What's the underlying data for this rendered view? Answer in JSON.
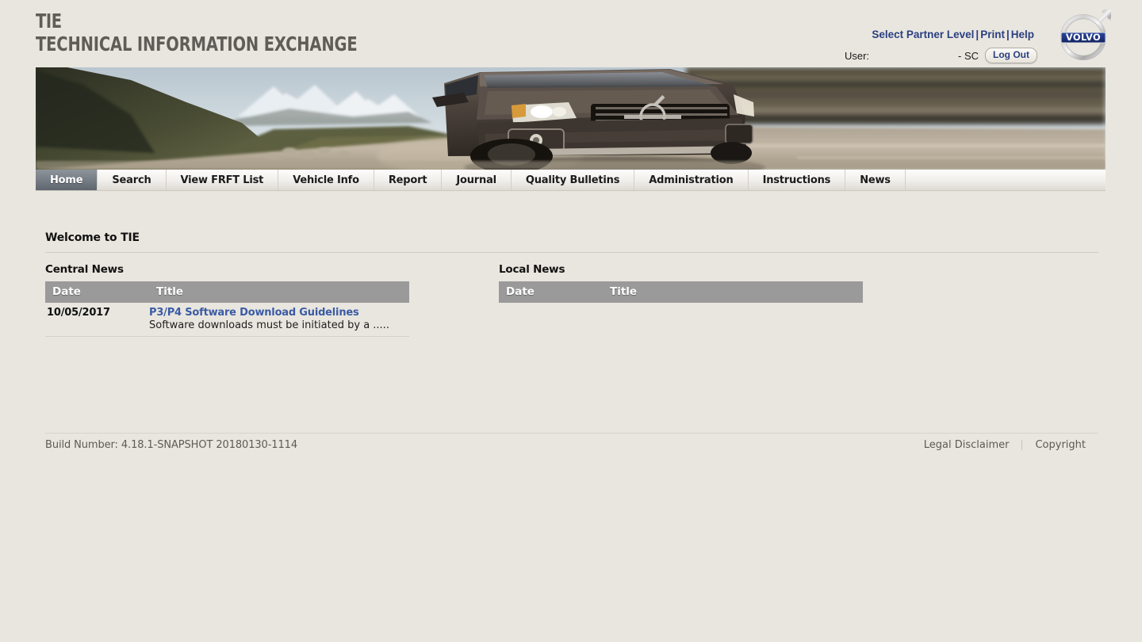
{
  "header": {
    "brand_abbr": "TIE",
    "brand_full": "TECHNICAL INFORMATION EXCHANGE",
    "links": [
      {
        "label": "Select Partner Level",
        "name": "select-partner-level-link"
      },
      {
        "label": "Print",
        "name": "print-link"
      },
      {
        "label": "Help",
        "name": "help-link"
      }
    ],
    "separator": "|",
    "user_label": "User:",
    "user_value": "- SC",
    "logout_label": "Log Out",
    "logo_text": "VOLVO",
    "logo_icon": "volvo-iron-mark-icon"
  },
  "banner": {
    "alt": "Volvo XC70 driving on mountain road",
    "icon": "banner-hero-image"
  },
  "nav": {
    "tabs": [
      {
        "label": "Home",
        "active": true
      },
      {
        "label": "Search",
        "active": false
      },
      {
        "label": "View FRFT List",
        "active": false
      },
      {
        "label": "Vehicle Info",
        "active": false
      },
      {
        "label": "Report",
        "active": false
      },
      {
        "label": "Journal",
        "active": false
      },
      {
        "label": "Quality Bulletins",
        "active": false
      },
      {
        "label": "Administration",
        "active": false
      },
      {
        "label": "Instructions",
        "active": false
      },
      {
        "label": "News",
        "active": false
      }
    ]
  },
  "main": {
    "welcome": "Welcome to TIE",
    "central_news": {
      "title": "Central News",
      "columns": [
        "Date",
        "Title"
      ],
      "rows": [
        {
          "date": "10/05/2017",
          "title": "P3/P4 Software Download Guidelines",
          "description": "Software downloads must be initiated by a ....."
        }
      ]
    },
    "local_news": {
      "title": "Local News",
      "columns": [
        "Date",
        "Title"
      ],
      "rows": []
    }
  },
  "footer": {
    "build": "Build Number: 4.18.1-SNAPSHOT 20180130-1114",
    "legal_disclaimer": "Legal Disclaimer",
    "copyright": "Copyright"
  },
  "colors": {
    "page_background": "#e9e6df",
    "link_blue": "#2a3f82",
    "news_link_blue": "#3b5ba5",
    "table_header_gray": "#9a9a9a",
    "active_tab_gray": "#767d85",
    "volvo_badge_blue": "#1b2f7a"
  }
}
